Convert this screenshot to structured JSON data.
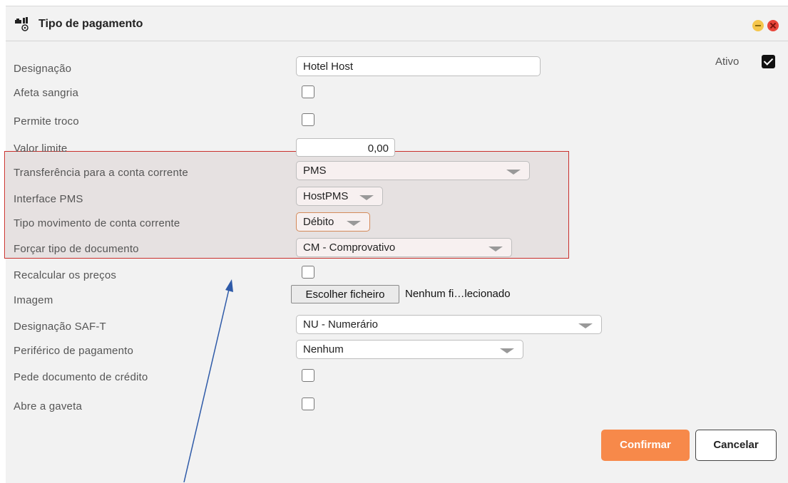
{
  "window": {
    "title": "Tipo de pagamento",
    "icon": "payment-settings-icon",
    "controls": [
      "minimize-icon",
      "close-icon"
    ]
  },
  "form": {
    "designacao": {
      "label": "Designação",
      "value": "Hotel Host"
    },
    "ativo": {
      "label": "Ativo",
      "checked": true
    },
    "afeta_sangria": {
      "label": "Afeta sangria",
      "checked": false
    },
    "permite_troco": {
      "label": "Permite troco",
      "checked": false
    },
    "valor_limite": {
      "label": "Valor limite",
      "value": "0,00"
    },
    "transferencia": {
      "label": "Transferência para a conta corrente",
      "value": "PMS"
    },
    "interface_pms": {
      "label": "Interface PMS",
      "value": "HostPMS"
    },
    "tipo_movimento": {
      "label": "Tipo movimento de conta corrente",
      "value": "Débito"
    },
    "forcar_tipo": {
      "label": "Forçar tipo de documento",
      "value": "CM - Comprovativo"
    },
    "recalcular": {
      "label": "Recalcular os preços",
      "checked": false
    },
    "imagem": {
      "label": "Imagem",
      "button": "Escolher ficheiro",
      "file_status": "Nenhum fi…lecionado"
    },
    "designacao_saft": {
      "label": "Designação SAF-T",
      "value": "NU - Numerário"
    },
    "periferico": {
      "label": "Periférico de pagamento",
      "value": "Nenhum"
    },
    "pede_documento": {
      "label": "Pede documento de crédito",
      "checked": false
    },
    "abre_gaveta": {
      "label": "Abre a gaveta",
      "checked": false
    }
  },
  "buttons": {
    "confirm": "Confirmar",
    "cancel": "Cancelar"
  },
  "colors": {
    "highlight_border": "#c9302c",
    "confirm_bg": "#f7894a",
    "annotation_arrow": "#2e5aa8"
  }
}
